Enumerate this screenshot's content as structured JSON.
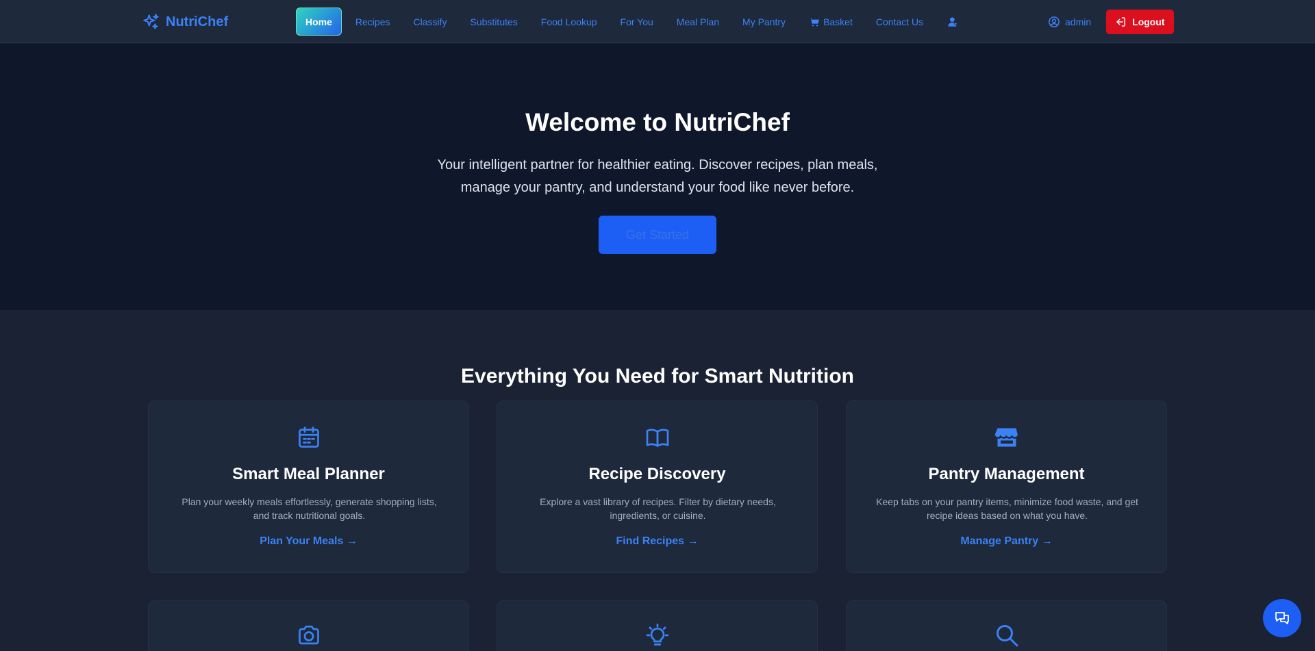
{
  "brand": {
    "name": "NutriChef",
    "icon": "sparkles-icon"
  },
  "nav": {
    "items": [
      {
        "label": "Home",
        "active": true
      },
      {
        "label": "Recipes"
      },
      {
        "label": "Classify"
      },
      {
        "label": "Substitutes"
      },
      {
        "label": "Food Lookup"
      },
      {
        "label": "For You"
      },
      {
        "label": "Meal Plan"
      },
      {
        "label": "My Pantry"
      },
      {
        "label": "Basket",
        "icon": "cart-icon"
      },
      {
        "label": "Contact Us"
      }
    ],
    "user_icon": "user-icon",
    "admin_label": "admin",
    "logout_label": "Logout"
  },
  "hero": {
    "title": "Welcome to NutriChef",
    "subtitle": "Your intelligent partner for healthier eating. Discover recipes, plan meals, manage your pantry, and understand your food like never before.",
    "cta_label": "Get Started"
  },
  "features": {
    "title": "Everything You Need for Smart Nutrition",
    "cards": [
      {
        "icon": "calendar-icon",
        "title": "Smart Meal Planner",
        "description": "Plan your weekly meals effortlessly, generate shopping lists, and track nutritional goals.",
        "link": "Plan Your Meals →"
      },
      {
        "icon": "book-open-icon",
        "title": "Recipe Discovery",
        "description": "Explore a vast library of recipes. Filter by dietary needs, ingredients, or cuisine.",
        "link": "Find Recipes →"
      },
      {
        "icon": "store-icon",
        "title": "Pantry Management",
        "description": "Keep tabs on your pantry items, minimize food waste, and get recipe ideas based on what you have.",
        "link": "Manage Pantry →"
      },
      {
        "icon": "camera-icon"
      },
      {
        "icon": "lightbulb-icon"
      },
      {
        "icon": "search-icon"
      }
    ]
  },
  "chat": {
    "icon": "chat-bubbles-icon"
  },
  "colors": {
    "accent": "#3b82f6",
    "logout": "#dc0f1e",
    "hero_bg": "#0f172a",
    "page_bg": "#1a2233",
    "card_bg": "#1e293b"
  }
}
